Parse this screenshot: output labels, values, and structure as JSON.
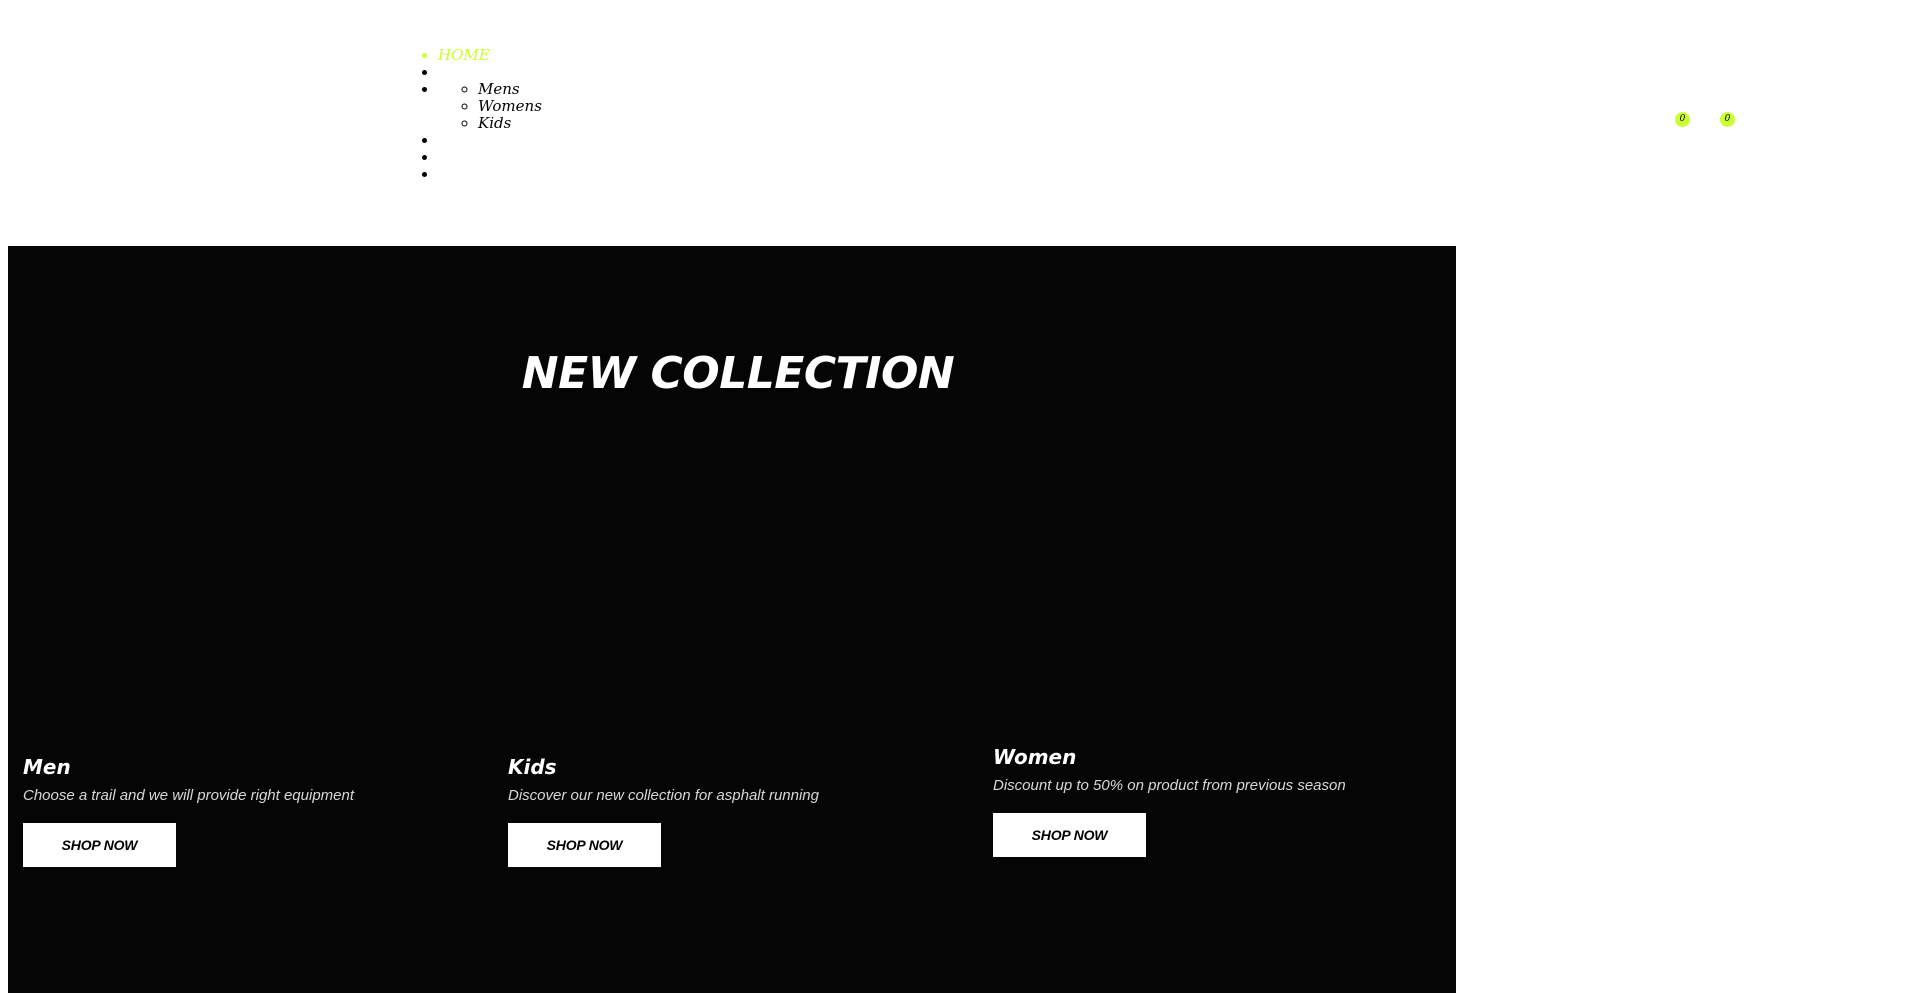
{
  "nav": {
    "items": [
      {
        "label": "HOME",
        "active": true
      },
      {
        "label": ""
      },
      {
        "label": "",
        "children": [
          "Mens",
          "Womens",
          "Kids"
        ]
      },
      {
        "label": ""
      },
      {
        "label": ""
      },
      {
        "label": ""
      }
    ],
    "wishlist_count": "0",
    "cart_count": "0"
  },
  "colors": {
    "accent": "#c9ff34",
    "hero_bg": "#050505"
  },
  "hero": {
    "title": "NEW COLLECTION",
    "collections": [
      {
        "name": "Men",
        "description": "Choose a trail and we will provide right equipment",
        "button": "SHOP NOW"
      },
      {
        "name": "Kids",
        "description": "Discover our new collection for asphalt running",
        "button": "SHOP NOW"
      },
      {
        "name": "Women",
        "description": "Discount up to 50% on product from previous season",
        "button": "SHOP NOW"
      }
    ]
  }
}
